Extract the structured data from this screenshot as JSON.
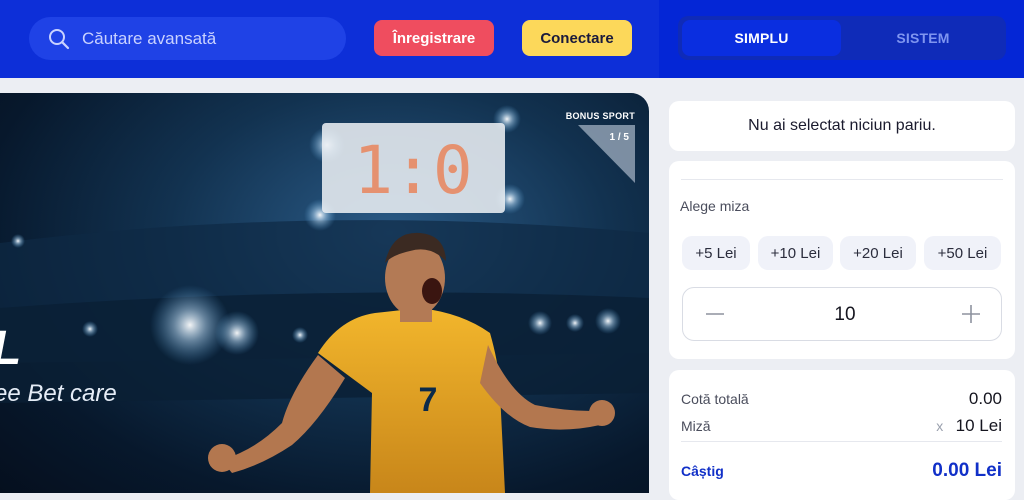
{
  "header": {
    "search": {
      "placeholder": "Căutare avansată",
      "icon": "search-icon"
    },
    "register_label": "Înregistrare",
    "login_label": "Conectare"
  },
  "betslip_tabs": [
    {
      "label": "SIMPLU",
      "active": true
    },
    {
      "label": "SISTEM",
      "active": false
    }
  ],
  "banner": {
    "badge": "BONUS SPORT",
    "slide_counter": "1 / 5",
    "scoreboard": "1:0",
    "jersey_number": "7",
    "headline_fragment": "L",
    "subline_fragment": "ee Bet care"
  },
  "betslip": {
    "empty_message": "Nu ai selectat niciun pariu.",
    "stake_label": "Alege miza",
    "quick_stakes": [
      "+5 Lei",
      "+10 Lei",
      "+20 Lei",
      "+50 Lei"
    ],
    "stake_value": "10",
    "total_odds_label": "Cotă totală",
    "total_odds_value": "0.00",
    "stake_row_label": "Miză",
    "stake_multiplier": "x",
    "stake_row_value": "10 Lei",
    "win_label": "Câștig",
    "win_value": "0.00 Lei"
  },
  "colors": {
    "header_bg": "#0d2fd8",
    "register_bg": "#ef4d5f",
    "login_bg": "#fcd85a",
    "accent_blue": "#1130c8"
  }
}
